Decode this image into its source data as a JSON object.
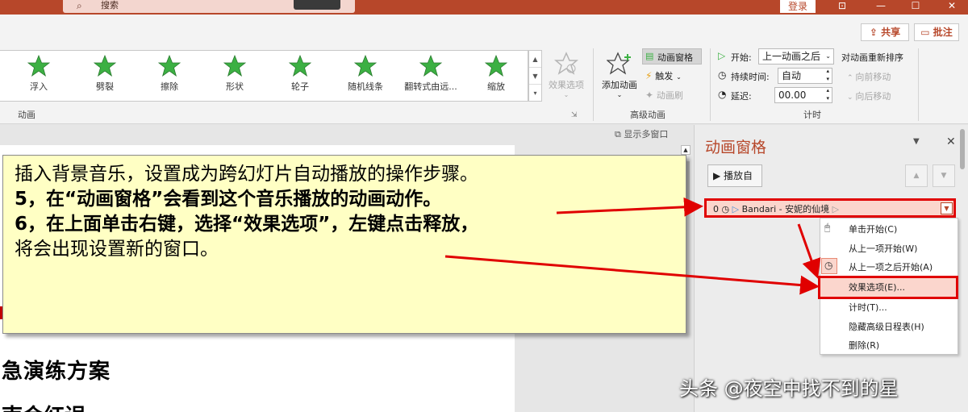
{
  "titlebar": {
    "search_placeholder": "搜索",
    "login": "登录",
    "icons": [
      "search-icon",
      "ribbon-display-icon",
      "minimize-icon",
      "maximize-icon",
      "close-icon"
    ]
  },
  "ribbon": {
    "share": "共享",
    "comment": "批注",
    "gallery_items": [
      "浮入",
      "劈裂",
      "擦除",
      "形状",
      "轮子",
      "随机线条",
      "翻转式由远...",
      "缩放"
    ],
    "group_animation": "动画",
    "effect_options": "效果选项",
    "add_animation": "添加动画",
    "animation_pane": "动画窗格",
    "trigger": "触发",
    "animation_painter": "动画刷",
    "group_advanced": "高级动画",
    "start_label": "开始:",
    "start_value": "上一动画之后",
    "duration_label": "持续时间:",
    "duration_value": "自动",
    "delay_label": "延迟:",
    "delay_value": "00.00",
    "reorder_title": "对动画重新排序",
    "move_earlier": "向前移动",
    "move_later": "向后移动",
    "group_timing": "计时"
  },
  "slide": {
    "multi_window": "显示多窗口",
    "title_line1": "急演练方案",
    "title_line2": "南会红误"
  },
  "callout": {
    "line1": "插入背景音乐，设置成为跨幻灯片自动播放的操作步骤。",
    "line2": "5，在“动画窗格”会看到这个音乐播放的动画动作。",
    "line3": "6，在上面单击右键，选择“效果选项”，左键点击释放，",
    "line4": "将会出现设置新的窗口。"
  },
  "pane": {
    "title": "动画窗格",
    "play": "播放自",
    "item_index": "0",
    "item_name": "Bandari - 安妮的仙境"
  },
  "context_menu": {
    "items": [
      "单击开始(C)",
      "从上一项开始(W)",
      "从上一项之后开始(A)",
      "效果选项(E)...",
      "计时(T)...",
      "隐藏高级日程表(H)",
      "删除(R)"
    ]
  },
  "watermark": "头条 @夜空中找不到的星",
  "colors": {
    "accent": "#b7472a",
    "highlight_red": "#e00000",
    "callout_bg": "#ffffc4",
    "star_green": "#3cb043"
  }
}
